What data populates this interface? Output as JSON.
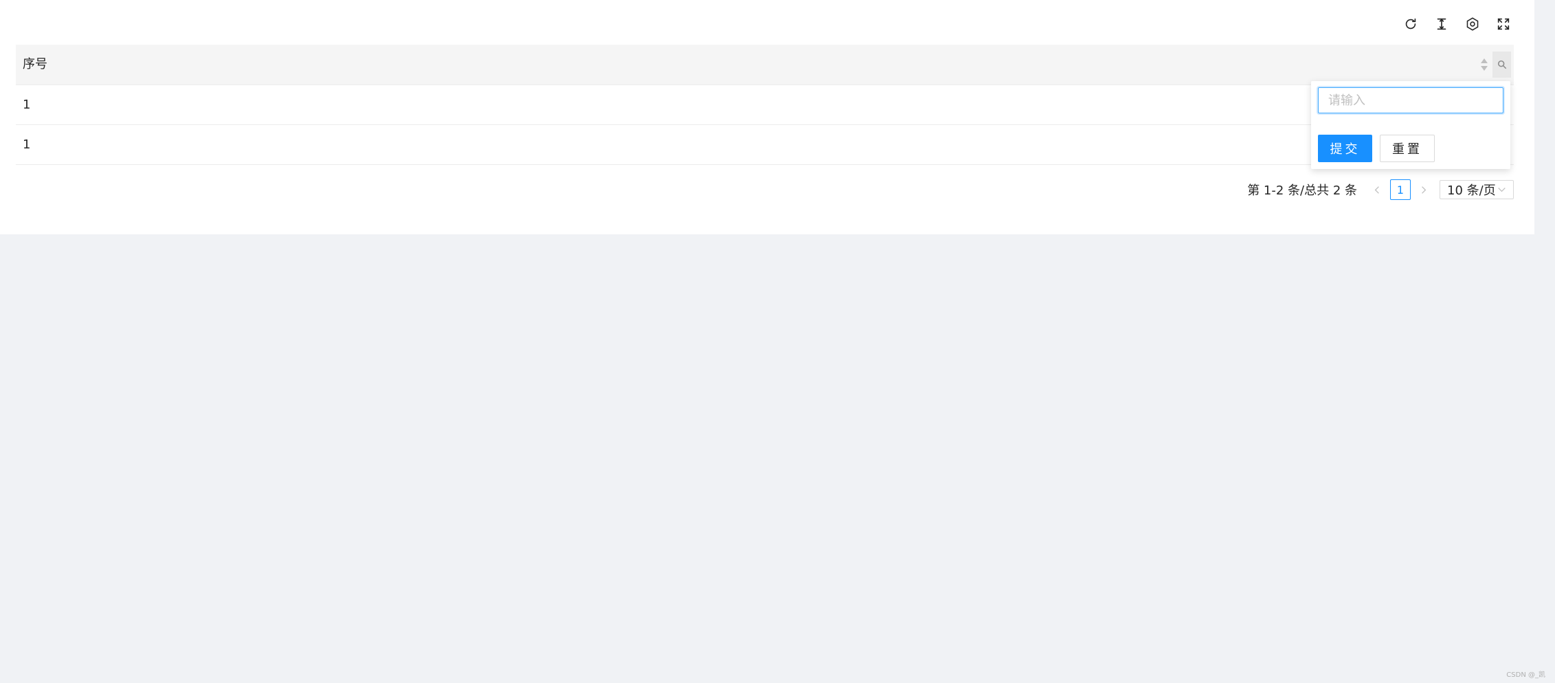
{
  "toolbar": {
    "icons": [
      "reload-icon",
      "column-height-icon",
      "setting-icon",
      "fullscreen-icon"
    ]
  },
  "table": {
    "columns": [
      {
        "title": "序号"
      }
    ],
    "rows": [
      {
        "index": "1"
      },
      {
        "index": "1"
      }
    ]
  },
  "filter_dropdown": {
    "placeholder": "请输入",
    "value": "",
    "submit_label": "提交",
    "reset_label": "重置"
  },
  "pagination": {
    "total_text": "第 1-2 条/总共 2 条",
    "current_page": "1",
    "prev_icon": "<",
    "next_icon": ">",
    "page_size": "10 条/页"
  },
  "watermark": "CSDN @_凯",
  "colors": {
    "primary": "#1890ff",
    "background": "#f0f2f5",
    "header_bg": "#f5f5f5"
  }
}
